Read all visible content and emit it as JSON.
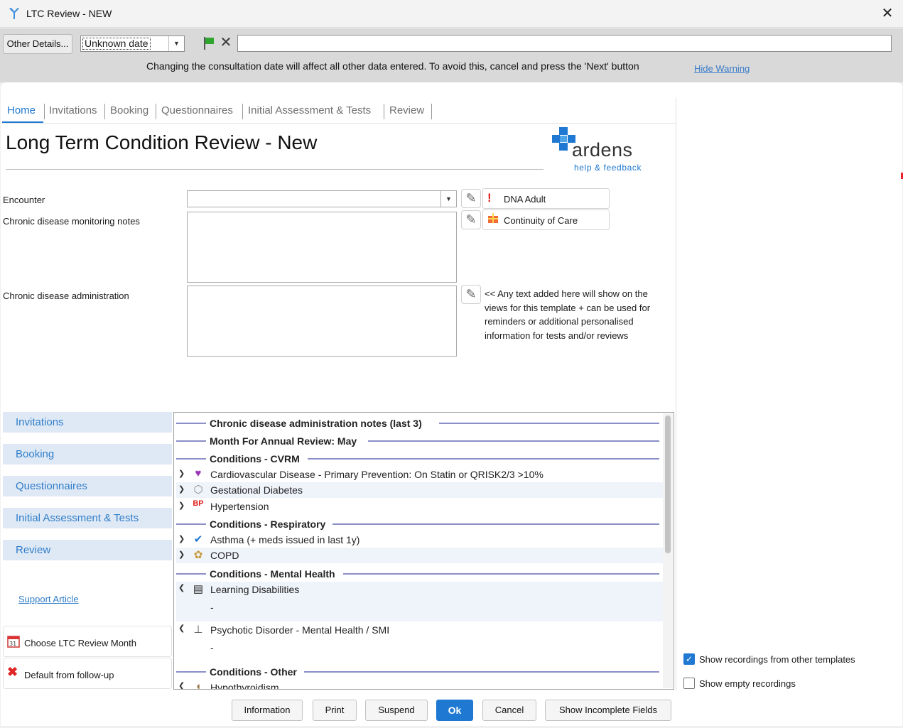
{
  "window": {
    "title": "LTC Review - NEW",
    "close_label": "✕"
  },
  "toolbar": {
    "other_details_label": "Other Details...",
    "date_value": "Unknown date",
    "free_text_value": "",
    "warning_text": "Changing the consultation date will affect all other data entered. To avoid this, cancel and press the 'Next' button",
    "hide_warning_label": "Hide Warning"
  },
  "tabs": [
    {
      "label": "Home",
      "active": true
    },
    {
      "label": "Invitations"
    },
    {
      "label": "Booking"
    },
    {
      "label": "Questionnaires"
    },
    {
      "label": "Initial Assessment & Tests"
    },
    {
      "label": "Review"
    }
  ],
  "page": {
    "title": "Long Term Condition Review - New"
  },
  "logo": {
    "brand": "ardens",
    "help_link": "help & feedback"
  },
  "form": {
    "encounter_label": "Encounter",
    "encounter_value": "",
    "monitoring_label": "Chronic disease monitoring notes",
    "admin_label": "Chronic disease administration",
    "admin_note": "<< Any text added here will show on the views for this template + can be used for reminders or additional personalised information for tests and/or reviews"
  },
  "side_buttons": [
    {
      "label": "DNA Adult",
      "icon": "exclamation-icon"
    },
    {
      "label": "Continuity of Care",
      "icon": "gift-icon"
    }
  ],
  "nav": {
    "items": [
      "Invitations",
      "Booking",
      "Questionnaires",
      "Initial Assessment & Tests",
      "Review"
    ],
    "support_label": "Support Article"
  },
  "actions": [
    {
      "label": "Choose LTC Review Month",
      "icon": "calendar-icon"
    },
    {
      "label": "Default from follow-up",
      "icon": "red-cross-icon"
    }
  ],
  "list": {
    "sections": [
      "Chronic disease administration notes (last 3)",
      "Month For Annual Review: May",
      "Conditions - CVRM",
      "Conditions - Respiratory",
      "Conditions - Mental Health",
      "Conditions - Other"
    ],
    "rows": [
      {
        "label": "Cardiovascular Disease - Primary Prevention: On Statin or QRISK2/3 >10%",
        "icon": "heart-alert-icon"
      },
      {
        "label": "Gestational Diabetes",
        "icon": "glucose-drop-icon"
      },
      {
        "label": "Hypertension",
        "icon": "blood-pressure-icon"
      },
      {
        "label": "Asthma (+ meds issued in last 1y)",
        "icon": "checkmark-icon"
      },
      {
        "label": "COPD",
        "icon": "lungs-icon"
      },
      {
        "label": "Learning Disabilities",
        "icon": "id-card-icon",
        "value": "-"
      },
      {
        "label": "Psychotic Disorder - Mental Health / SMI",
        "icon": "branch-icon",
        "value": "-"
      },
      {
        "label": "Hypothyroidism",
        "icon": "thyroid-icon"
      }
    ]
  },
  "options": {
    "show_other_templates_label": "Show recordings from other templates",
    "show_other_templates_checked": true,
    "show_empty_label": "Show empty recordings",
    "show_empty_checked": false
  },
  "buttons": {
    "information": "Information",
    "print": "Print",
    "suspend": "Suspend",
    "ok": "Ok",
    "cancel": "Cancel",
    "show_incomplete": "Show Incomplete Fields"
  },
  "colors": {
    "accent": "#1f78d1",
    "nav_bg": "#dfe9f5",
    "section_line": "#8b8ec7"
  }
}
